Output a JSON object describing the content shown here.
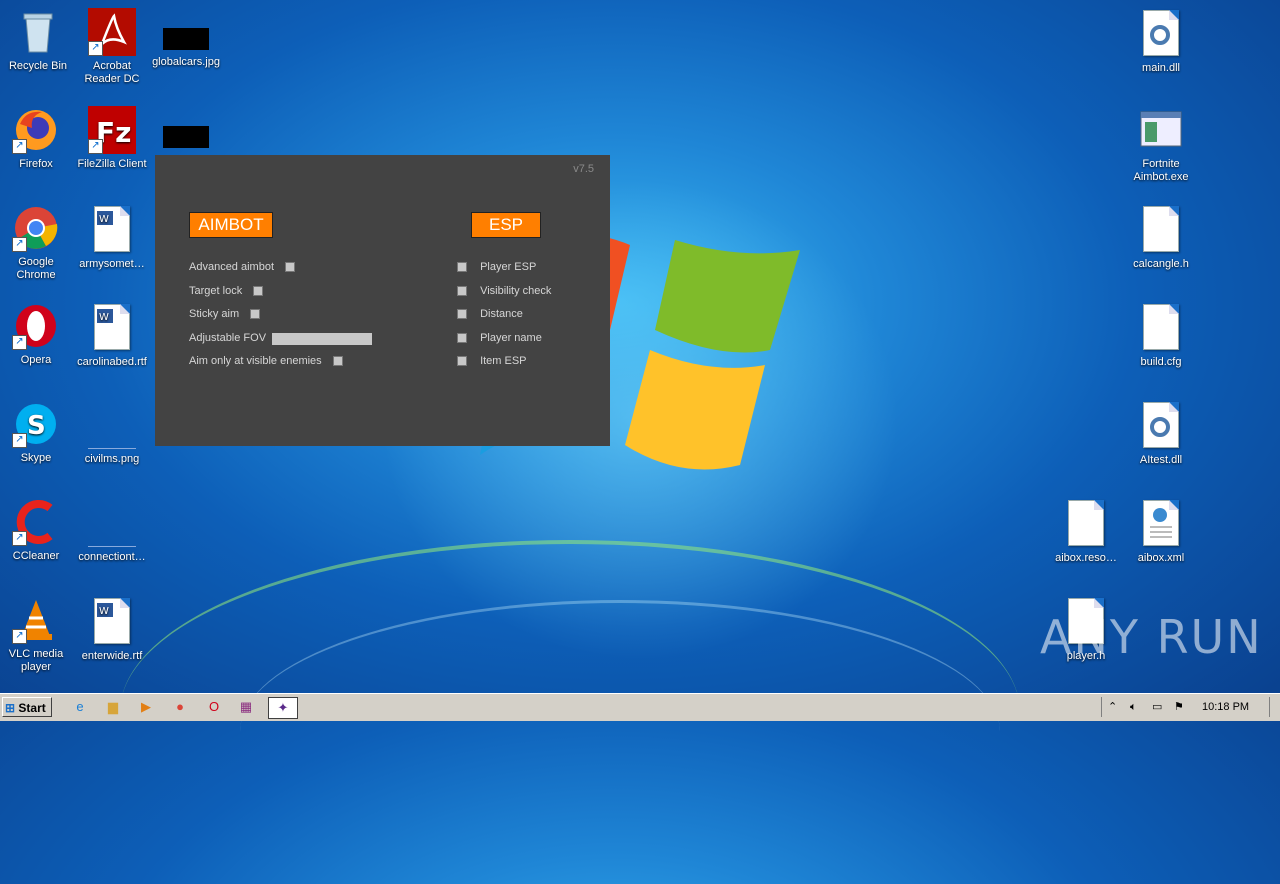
{
  "desktop_icons": {
    "recycle_bin": "Recycle Bin",
    "acrobat": "Acrobat Reader DC",
    "globalcars": "globalcars.jpg",
    "firefox": "Firefox",
    "filezilla": "FileZilla Client",
    "chrome": "Google Chrome",
    "armysomet": "armysomet…",
    "opera": "Opera",
    "carolinabed": "carolinabed.rtf",
    "skype": "Skype",
    "civilms": "civilms.png",
    "ccleaner": "CCleaner",
    "connectiont": "connectiont…",
    "vlc": "VLC media player",
    "enterwide": "enterwide.rtf",
    "main_dll": "main.dll",
    "fortnite": "Fortnite Aimbot.exe",
    "calcangle": "calcangle.h",
    "build_cfg": "build.cfg",
    "aitest": "AItest.dll",
    "aibox_reso": "aibox.reso…",
    "aibox_xml": "aibox.xml",
    "player_h": "player.h"
  },
  "cheat_window": {
    "version": "v7.5",
    "aimbot_label": "AIMBOT",
    "esp_label": "ESP",
    "aimbot_options": [
      "Advanced aimbot",
      "Target lock",
      "Sticky aim",
      "Adjustable FOV",
      "Aim only at visible enemies"
    ],
    "esp_options": [
      "Player ESP",
      "Visibility check",
      "Distance",
      "Player name",
      "Item ESP"
    ]
  },
  "taskbar": {
    "start_label": "Start",
    "clock": "10:18 PM"
  },
  "watermark": "ANY RUN"
}
